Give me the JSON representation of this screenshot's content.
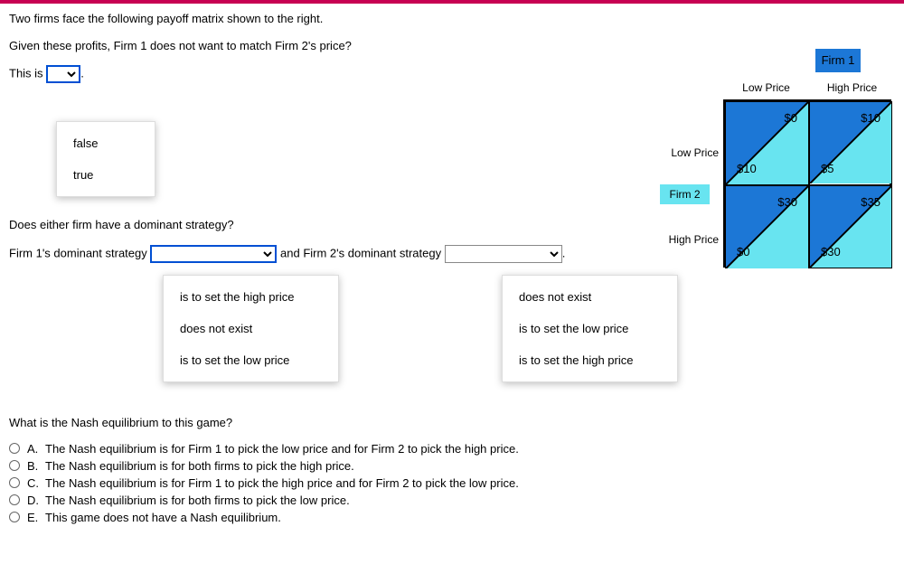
{
  "q1_intro": "Two firms face the following payoff matrix shown to the right.",
  "q1_stem": "Given these profits, Firm 1 does not want to match Firm 2's price?",
  "this_is": "This is",
  "dd1_options": [
    "false",
    "true"
  ],
  "q2": "Does either firm have a dominant strategy?",
  "q2_prefix": "Firm 1's dominant strategy",
  "q2_middle": "and Firm 2's dominant strategy",
  "dd2_options": [
    "is to set the high price",
    "does not exist",
    "is to set the low price"
  ],
  "dd3_options": [
    "does not exist",
    "is to set the low price",
    "is to set the high price"
  ],
  "q3": "What is the Nash equilibrium to this game?",
  "choices": [
    {
      "letter": "A.",
      "text": "The Nash equilibrium is for Firm 1 to pick the low price and for Firm 2 to pick the high price."
    },
    {
      "letter": "B.",
      "text": "The Nash equilibrium is for both firms to pick the high price."
    },
    {
      "letter": "C.",
      "text": "The Nash equilibrium is for Firm 1 to pick the high price and for Firm 2 to pick the low price."
    },
    {
      "letter": "D.",
      "text": "The Nash equilibrium is for both firms to pick the low price."
    },
    {
      "letter": "E.",
      "text": "This game does not have a Nash equilibrium."
    }
  ],
  "matrix": {
    "firm1": "Firm 1",
    "firm2": "Firm 2",
    "low": "Low Price",
    "high": "High Price",
    "cells": {
      "c00": {
        "upper": "$0",
        "lower": "$10"
      },
      "c01": {
        "upper": "$10",
        "lower": "$5"
      },
      "c10": {
        "upper": "$30",
        "lower": "$0"
      },
      "c11": {
        "upper": "$35",
        "lower": "$30"
      }
    },
    "colors": {
      "dark": "#1c77d6",
      "light": "#68e4f0"
    }
  },
  "chart_data": {
    "type": "table",
    "description": "2x2 game theory payoff matrix. Each cell split diagonally; upper-right triangle = Firm 1 payoff, lower-left triangle = Firm 2 payoff.",
    "row_player": "Firm 2",
    "col_player": "Firm 1",
    "row_strategies": [
      "Low Price",
      "High Price"
    ],
    "col_strategies": [
      "Low Price",
      "High Price"
    ],
    "payoffs": [
      [
        {
          "firm1": 0,
          "firm2": 10
        },
        {
          "firm1": 10,
          "firm2": 5
        }
      ],
      [
        {
          "firm1": 30,
          "firm2": 0
        },
        {
          "firm1": 35,
          "firm2": 30
        }
      ]
    ]
  }
}
